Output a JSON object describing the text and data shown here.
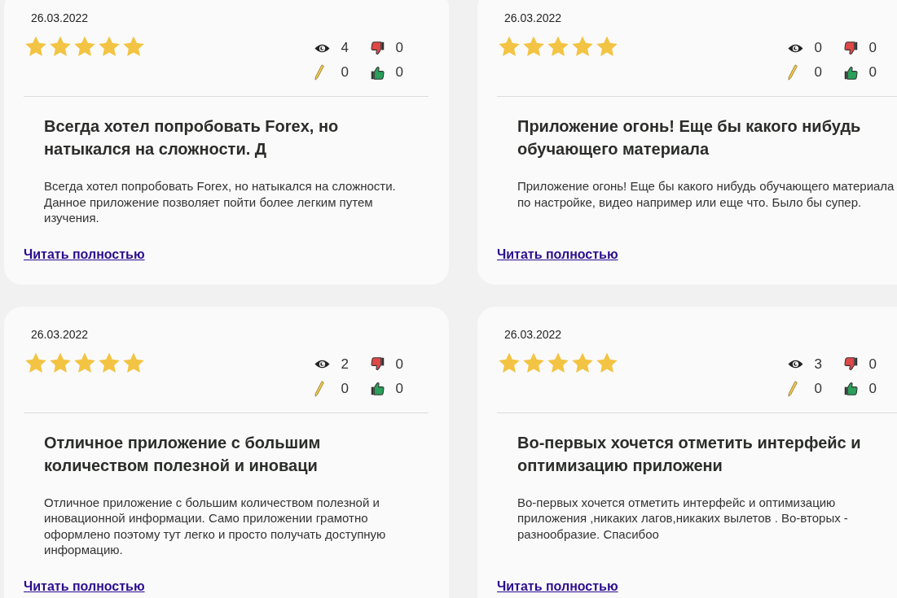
{
  "reviews": [
    {
      "date": "26.03.2022",
      "stars": 5,
      "stats": {
        "views": "4",
        "dislikes": "0",
        "comments": "0",
        "likes": "0"
      },
      "title": "Всегда хотел попробовать Forex, но натыкался на сложности. Д",
      "text": "Всегда хотел попробовать Forex, но натыкался на сложности. Данное приложение позволяет пойти более легким путем изучения.",
      "link": "Читать полностью"
    },
    {
      "date": "26.03.2022",
      "stars": 5,
      "stats": {
        "views": "0",
        "dislikes": "0",
        "comments": "0",
        "likes": "0"
      },
      "title": "Приложение огонь! Еще бы какого нибудь обучающего материала",
      "text": "Приложение огонь! Еще бы какого нибудь обучающего материала по настройке, видео например или еще что. Было бы супер.",
      "link": "Читать полностью"
    },
    {
      "date": "26.03.2022",
      "stars": 5,
      "stats": {
        "views": "2",
        "dislikes": "0",
        "comments": "0",
        "likes": "0"
      },
      "title": "Отличное приложение с большим количеством полезной и иноваци",
      "text": "Отличное приложение с большим количеством полезной и иновационной информации. Само приложении грамотно оформлено поэтому тут легко и просто получать доступную информацию.",
      "link": "Читать полностью"
    },
    {
      "date": "26.03.2022",
      "stars": 5,
      "stats": {
        "views": "3",
        "dislikes": "0",
        "comments": "0",
        "likes": "0"
      },
      "title": "Во-первых хочется отметить интерфейс и оптимизацию приложени",
      "text": "Во-первых хочется отметить интерфейс и оптимизацию приложения ,никаких лагов,никаких вылетов . Во-вторых - разнообразие. Спасибоо",
      "link": "Читать полностью"
    }
  ]
}
